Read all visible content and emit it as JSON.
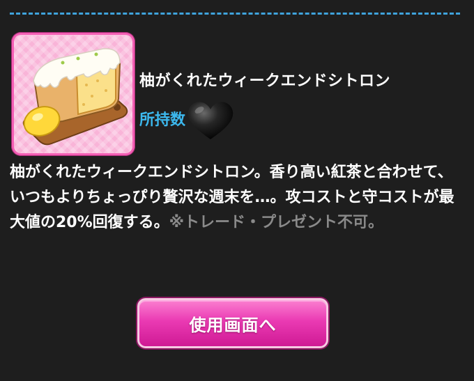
{
  "item": {
    "name": "柚がくれたウィークエンドシトロン",
    "owned_label": "所持数",
    "description": "柚がくれたウィークエンドシトロン。香り高い紅茶と合わせて、いつもよりちょっぴり贅沢な週末を…。攻コストと守コストが最大値の20%回復する。",
    "note": "※トレード・プレゼント不可。",
    "icon": "lemon-pound-cake-icon"
  },
  "actions": {
    "use_screen_label": "使用画面へ"
  },
  "colors": {
    "background": "#1e1e1e",
    "divider": "#3fa3dc",
    "owned_label": "#3cb8ee",
    "button": "#ea3ab3",
    "note": "#8a8a8a"
  }
}
